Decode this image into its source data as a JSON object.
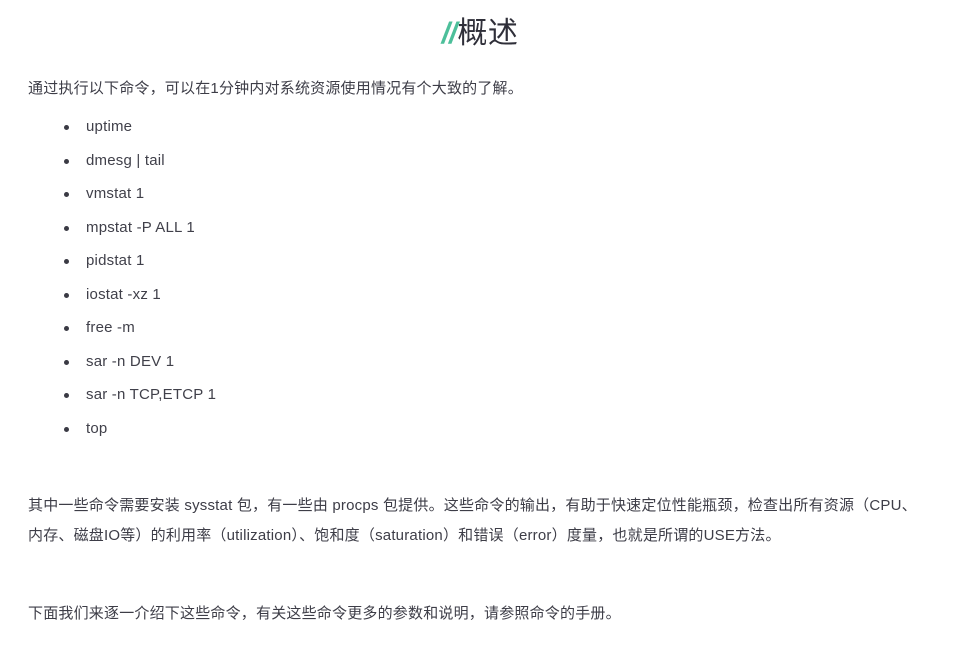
{
  "document": {
    "title": {
      "marker": "//",
      "text": "概述"
    },
    "intro_paragraph": "通过执行以下命令，可以在1分钟内对系统资源使用情况有个大致的了解。",
    "command_list": [
      {
        "command": "uptime"
      },
      {
        "command": "dmesg | tail"
      },
      {
        "command": "vmstat 1"
      },
      {
        "command": "mpstat -P ALL 1"
      },
      {
        "command": "pidstat 1"
      },
      {
        "command": "iostat -xz 1"
      },
      {
        "command": "free -m"
      },
      {
        "command": "sar -n DEV 1"
      },
      {
        "command": "sar -n TCP,ETCP 1"
      },
      {
        "command": "top"
      }
    ],
    "body_paragraph": "其中一些命令需要安装 sysstat 包，有一些由 procps 包提供。这些命令的输出，有助于快速定位性能瓶颈，检查出所有资源（CPU、内存、磁盘IO等）的利用率（utilization）、饱和度（saturation）和错误（error）度量，也就是所谓的USE方法。",
    "closing_paragraph": "下面我们来逐一介绍下这些命令，有关这些命令更多的参数和说明，请参照命令的手册。"
  },
  "theme": {
    "background": "#ffffff",
    "text_color": "#3d3d47",
    "title_color": "#2f2f39",
    "accent_color": "#4cbf9a",
    "bullet_color": "#3a3a44"
  }
}
